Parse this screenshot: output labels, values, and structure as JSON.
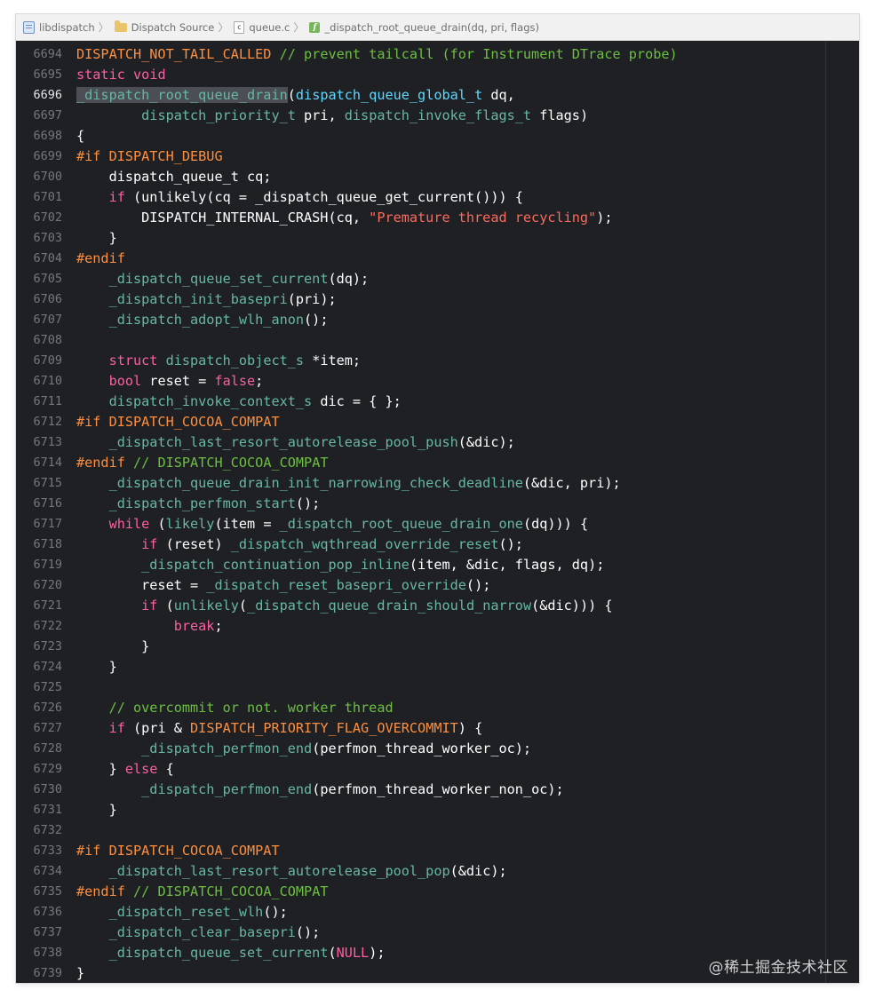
{
  "breadcrumb": [
    {
      "label": "libdispatch",
      "icon": "project-icon"
    },
    {
      "label": "Dispatch Source",
      "icon": "folder-icon"
    },
    {
      "label": "queue.c",
      "icon": "c-file-icon"
    },
    {
      "label": "_dispatch_root_queue_drain(dq, pri, flags)",
      "icon": "function-icon"
    }
  ],
  "colors": {
    "background": "#1f2024",
    "plain": "#ffffff",
    "keyword": "#fc5fa3",
    "preprocessor": "#fd8f3f",
    "function": "#67b7a4",
    "type": "#5dd8ff",
    "comment": "#6cbf43",
    "string": "#fc6a5d",
    "macro": "#fd8f3f",
    "selection": "#4c4e55"
  },
  "current_line": "6696",
  "code_lines": [
    {
      "n": "6694",
      "t": [
        [
          "pp",
          "DISPATCH_NOT_TAIL_CALLED"
        ],
        [
          "p",
          " "
        ],
        [
          "c",
          "// prevent tailcall (for Instrument DTrace probe)"
        ]
      ]
    },
    {
      "n": "6695",
      "t": [
        [
          "k",
          "static"
        ],
        [
          "p",
          " "
        ],
        [
          "k",
          "void"
        ]
      ]
    },
    {
      "n": "6696",
      "t": [
        [
          "fsel",
          "_dispatch_root_queue_drain"
        ],
        [
          "p",
          "("
        ],
        [
          "ty",
          "dispatch_queue_global_t"
        ],
        [
          "p",
          " dq,"
        ]
      ]
    },
    {
      "n": "6697",
      "t": [
        [
          "p",
          "        "
        ],
        [
          "f",
          "dispatch_priority_t"
        ],
        [
          "p",
          " pri, "
        ],
        [
          "f",
          "dispatch_invoke_flags_t"
        ],
        [
          "p",
          " flags)"
        ]
      ]
    },
    {
      "n": "6698",
      "t": [
        [
          "p",
          "{"
        ]
      ]
    },
    {
      "n": "6699",
      "t": [
        [
          "pp",
          "#if DISPATCH_DEBUG"
        ]
      ]
    },
    {
      "n": "6700",
      "t": [
        [
          "p",
          "    dispatch_queue_t cq;"
        ]
      ]
    },
    {
      "n": "6701",
      "t": [
        [
          "p",
          "    "
        ],
        [
          "k",
          "if"
        ],
        [
          "p",
          " (unlikely(cq = _dispatch_queue_get_current())) {"
        ]
      ]
    },
    {
      "n": "6702",
      "t": [
        [
          "p",
          "        DISPATCH_INTERNAL_CRASH(cq, "
        ],
        [
          "s",
          "\"Premature thread recycling\""
        ],
        [
          "p",
          ");"
        ]
      ]
    },
    {
      "n": "6703",
      "t": [
        [
          "p",
          "    }"
        ]
      ]
    },
    {
      "n": "6704",
      "t": [
        [
          "pp",
          "#endif"
        ]
      ]
    },
    {
      "n": "6705",
      "t": [
        [
          "p",
          "    "
        ],
        [
          "f",
          "_dispatch_queue_set_current"
        ],
        [
          "p",
          "(dq);"
        ]
      ]
    },
    {
      "n": "6706",
      "t": [
        [
          "p",
          "    "
        ],
        [
          "f",
          "_dispatch_init_basepri"
        ],
        [
          "p",
          "(pri);"
        ]
      ]
    },
    {
      "n": "6707",
      "t": [
        [
          "p",
          "    "
        ],
        [
          "f",
          "_dispatch_adopt_wlh_anon"
        ],
        [
          "p",
          "();"
        ]
      ]
    },
    {
      "n": "6708",
      "t": []
    },
    {
      "n": "6709",
      "t": [
        [
          "p",
          "    "
        ],
        [
          "k",
          "struct"
        ],
        [
          "p",
          " "
        ],
        [
          "f",
          "dispatch_object_s"
        ],
        [
          "p",
          " *item;"
        ]
      ]
    },
    {
      "n": "6710",
      "t": [
        [
          "p",
          "    "
        ],
        [
          "k",
          "bool"
        ],
        [
          "p",
          " reset = "
        ],
        [
          "k",
          "false"
        ],
        [
          "p",
          ";"
        ]
      ]
    },
    {
      "n": "6711",
      "t": [
        [
          "p",
          "    "
        ],
        [
          "f",
          "dispatch_invoke_context_s"
        ],
        [
          "p",
          " dic = { };"
        ]
      ]
    },
    {
      "n": "6712",
      "t": [
        [
          "pp",
          "#if DISPATCH_COCOA_COMPAT"
        ]
      ]
    },
    {
      "n": "6713",
      "t": [
        [
          "p",
          "    "
        ],
        [
          "f",
          "_dispatch_last_resort_autorelease_pool_push"
        ],
        [
          "p",
          "(&dic);"
        ]
      ]
    },
    {
      "n": "6714",
      "t": [
        [
          "pp",
          "#endif"
        ],
        [
          "p",
          " "
        ],
        [
          "c",
          "// DISPATCH_COCOA_COMPAT"
        ]
      ]
    },
    {
      "n": "6715",
      "t": [
        [
          "p",
          "    "
        ],
        [
          "f",
          "_dispatch_queue_drain_init_narrowing_check_deadline"
        ],
        [
          "p",
          "(&dic, pri);"
        ]
      ]
    },
    {
      "n": "6716",
      "t": [
        [
          "p",
          "    "
        ],
        [
          "f",
          "_dispatch_perfmon_start"
        ],
        [
          "p",
          "();"
        ]
      ]
    },
    {
      "n": "6717",
      "t": [
        [
          "p",
          "    "
        ],
        [
          "k",
          "while"
        ],
        [
          "p",
          " ("
        ],
        [
          "f",
          "likely"
        ],
        [
          "p",
          "(item = "
        ],
        [
          "f",
          "_dispatch_root_queue_drain_one"
        ],
        [
          "p",
          "(dq))) {"
        ]
      ]
    },
    {
      "n": "6718",
      "t": [
        [
          "p",
          "        "
        ],
        [
          "k",
          "if"
        ],
        [
          "p",
          " (reset) "
        ],
        [
          "f",
          "_dispatch_wqthread_override_reset"
        ],
        [
          "p",
          "();"
        ]
      ]
    },
    {
      "n": "6719",
      "t": [
        [
          "p",
          "        "
        ],
        [
          "f",
          "_dispatch_continuation_pop_inline"
        ],
        [
          "p",
          "(item, &dic, flags, dq);"
        ]
      ]
    },
    {
      "n": "6720",
      "t": [
        [
          "p",
          "        reset = "
        ],
        [
          "f",
          "_dispatch_reset_basepri_override"
        ],
        [
          "p",
          "();"
        ]
      ]
    },
    {
      "n": "6721",
      "t": [
        [
          "p",
          "        "
        ],
        [
          "k",
          "if"
        ],
        [
          "p",
          " ("
        ],
        [
          "f",
          "unlikely"
        ],
        [
          "p",
          "("
        ],
        [
          "f",
          "_dispatch_queue_drain_should_narrow"
        ],
        [
          "p",
          "(&dic))) {"
        ]
      ]
    },
    {
      "n": "6722",
      "t": [
        [
          "p",
          "            "
        ],
        [
          "k",
          "break"
        ],
        [
          "p",
          ";"
        ]
      ]
    },
    {
      "n": "6723",
      "t": [
        [
          "p",
          "        }"
        ]
      ]
    },
    {
      "n": "6724",
      "t": [
        [
          "p",
          "    }"
        ]
      ]
    },
    {
      "n": "6725",
      "t": []
    },
    {
      "n": "6726",
      "t": [
        [
          "p",
          "    "
        ],
        [
          "c",
          "// overcommit or not. worker thread"
        ]
      ]
    },
    {
      "n": "6727",
      "t": [
        [
          "p",
          "    "
        ],
        [
          "k",
          "if"
        ],
        [
          "p",
          " (pri & "
        ],
        [
          "m",
          "DISPATCH_PRIORITY_FLAG_OVERCOMMIT"
        ],
        [
          "p",
          ") {"
        ]
      ]
    },
    {
      "n": "6728",
      "t": [
        [
          "p",
          "        "
        ],
        [
          "f",
          "_dispatch_perfmon_end"
        ],
        [
          "p",
          "(perfmon_thread_worker_oc);"
        ]
      ]
    },
    {
      "n": "6729",
      "t": [
        [
          "p",
          "    } "
        ],
        [
          "k",
          "else"
        ],
        [
          "p",
          " {"
        ]
      ]
    },
    {
      "n": "6730",
      "t": [
        [
          "p",
          "        "
        ],
        [
          "f",
          "_dispatch_perfmon_end"
        ],
        [
          "p",
          "(perfmon_thread_worker_non_oc);"
        ]
      ]
    },
    {
      "n": "6731",
      "t": [
        [
          "p",
          "    }"
        ]
      ]
    },
    {
      "n": "6732",
      "t": []
    },
    {
      "n": "6733",
      "t": [
        [
          "pp",
          "#if DISPATCH_COCOA_COMPAT"
        ]
      ]
    },
    {
      "n": "6734",
      "t": [
        [
          "p",
          "    "
        ],
        [
          "f",
          "_dispatch_last_resort_autorelease_pool_pop"
        ],
        [
          "p",
          "(&dic);"
        ]
      ]
    },
    {
      "n": "6735",
      "t": [
        [
          "pp",
          "#endif"
        ],
        [
          "p",
          " "
        ],
        [
          "c",
          "// DISPATCH_COCOA_COMPAT"
        ]
      ]
    },
    {
      "n": "6736",
      "t": [
        [
          "p",
          "    "
        ],
        [
          "f",
          "_dispatch_reset_wlh"
        ],
        [
          "p",
          "();"
        ]
      ]
    },
    {
      "n": "6737",
      "t": [
        [
          "p",
          "    "
        ],
        [
          "f",
          "_dispatch_clear_basepri"
        ],
        [
          "p",
          "();"
        ]
      ]
    },
    {
      "n": "6738",
      "t": [
        [
          "p",
          "    "
        ],
        [
          "f",
          "_dispatch_queue_set_current"
        ],
        [
          "p",
          "("
        ],
        [
          "k",
          "NULL"
        ],
        [
          "p",
          ");"
        ]
      ]
    },
    {
      "n": "6739",
      "t": [
        [
          "p",
          "}"
        ]
      ]
    }
  ],
  "watermark": "@稀土掘金技术社区"
}
